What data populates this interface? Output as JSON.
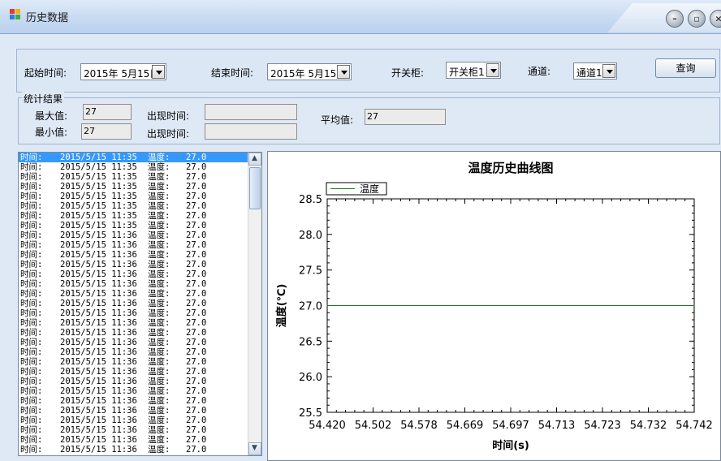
{
  "window": {
    "title": "历史数据"
  },
  "query": {
    "start_label": "起始时间:",
    "start_value": "2015年 5月15日",
    "end_label": "结束时间:",
    "end_value": "2015年 5月15日",
    "cabinet_label": "开关柜:",
    "cabinet_value": "开关柜1",
    "channel_label": "通道:",
    "channel_value": "通道1",
    "query_button": "查询"
  },
  "stats": {
    "legend": "统计结果",
    "max_label": "最大值:",
    "max_value": "27",
    "max_time_label": "出现时间:",
    "max_time_value": "",
    "min_label": "最小值:",
    "min_value": "27",
    "min_time_label": "出现时间:",
    "min_time_value": "",
    "avg_label": "平均值:",
    "avg_value": "27"
  },
  "records": [
    {
      "time_label": "时间:",
      "datetime": "2015/5/15 11:35",
      "temp_label": "温度:",
      "temp": "27.0"
    },
    {
      "time_label": "时间:",
      "datetime": "2015/5/15 11:35",
      "temp_label": "温度:",
      "temp": "27.0"
    },
    {
      "time_label": "时间:",
      "datetime": "2015/5/15 11:35",
      "temp_label": "温度:",
      "temp": "27.0"
    },
    {
      "time_label": "时间:",
      "datetime": "2015/5/15 11:35",
      "temp_label": "温度:",
      "temp": "27.0"
    },
    {
      "time_label": "时间:",
      "datetime": "2015/5/15 11:35",
      "temp_label": "温度:",
      "temp": "27.0"
    },
    {
      "time_label": "时间:",
      "datetime": "2015/5/15 11:35",
      "temp_label": "温度:",
      "temp": "27.0"
    },
    {
      "time_label": "时间:",
      "datetime": "2015/5/15 11:35",
      "temp_label": "温度:",
      "temp": "27.0"
    },
    {
      "time_label": "时间:",
      "datetime": "2015/5/15 11:35",
      "temp_label": "温度:",
      "temp": "27.0"
    },
    {
      "time_label": "时间:",
      "datetime": "2015/5/15 11:36",
      "temp_label": "温度:",
      "temp": "27.0"
    },
    {
      "time_label": "时间:",
      "datetime": "2015/5/15 11:36",
      "temp_label": "温度:",
      "temp": "27.0"
    },
    {
      "time_label": "时间:",
      "datetime": "2015/5/15 11:36",
      "temp_label": "温度:",
      "temp": "27.0"
    },
    {
      "time_label": "时间:",
      "datetime": "2015/5/15 11:36",
      "temp_label": "温度:",
      "temp": "27.0"
    },
    {
      "time_label": "时间:",
      "datetime": "2015/5/15 11:36",
      "temp_label": "温度:",
      "temp": "27.0"
    },
    {
      "time_label": "时间:",
      "datetime": "2015/5/15 11:36",
      "temp_label": "温度:",
      "temp": "27.0"
    },
    {
      "time_label": "时间:",
      "datetime": "2015/5/15 11:36",
      "temp_label": "温度:",
      "temp": "27.0"
    },
    {
      "time_label": "时间:",
      "datetime": "2015/5/15 11:36",
      "temp_label": "温度:",
      "temp": "27.0"
    },
    {
      "time_label": "时间:",
      "datetime": "2015/5/15 11:36",
      "temp_label": "温度:",
      "temp": "27.0"
    },
    {
      "time_label": "时间:",
      "datetime": "2015/5/15 11:36",
      "temp_label": "温度:",
      "temp": "27.0"
    },
    {
      "time_label": "时间:",
      "datetime": "2015/5/15 11:36",
      "temp_label": "温度:",
      "temp": "27.0"
    },
    {
      "time_label": "时间:",
      "datetime": "2015/5/15 11:36",
      "temp_label": "温度:",
      "temp": "27.0"
    },
    {
      "time_label": "时间:",
      "datetime": "2015/5/15 11:36",
      "temp_label": "温度:",
      "temp": "27.0"
    },
    {
      "time_label": "时间:",
      "datetime": "2015/5/15 11:36",
      "temp_label": "温度:",
      "temp": "27.0"
    },
    {
      "time_label": "时间:",
      "datetime": "2015/5/15 11:36",
      "temp_label": "温度:",
      "temp": "27.0"
    },
    {
      "time_label": "时间:",
      "datetime": "2015/5/15 11:36",
      "temp_label": "温度:",
      "temp": "27.0"
    },
    {
      "time_label": "时间:",
      "datetime": "2015/5/15 11:36",
      "temp_label": "温度:",
      "temp": "27.0"
    },
    {
      "time_label": "时间:",
      "datetime": "2015/5/15 11:36",
      "temp_label": "温度:",
      "temp": "27.0"
    },
    {
      "time_label": "时间:",
      "datetime": "2015/5/15 11:36",
      "temp_label": "温度:",
      "temp": "27.0"
    },
    {
      "time_label": "时间:",
      "datetime": "2015/5/15 11:36",
      "temp_label": "温度:",
      "temp": "27.0"
    },
    {
      "time_label": "时间:",
      "datetime": "2015/5/15 11:36",
      "temp_label": "温度:",
      "temp": "27.0"
    },
    {
      "time_label": "时间:",
      "datetime": "2015/5/15 11:36",
      "temp_label": "温度:",
      "temp": "27.0"
    },
    {
      "time_label": "时间:",
      "datetime": "2015/5/15 11:36",
      "temp_label": "温度:",
      "temp": "27.0"
    }
  ],
  "colors": {
    "selection": "#3399ff",
    "series_line": "#1f7a1f",
    "window_bg": "#dfe9f5"
  },
  "chart_data": {
    "type": "line",
    "title": "温度历史曲线图",
    "xlabel": "时间(s)",
    "ylabel": "温度(℃)",
    "x_tick_labels": [
      "54.420",
      "54.502",
      "54.578",
      "54.669",
      "54.697",
      "54.713",
      "54.723",
      "54.732",
      "54.742"
    ],
    "y_ticks": [
      "25.5",
      "26.0",
      "26.5",
      "27.0",
      "27.5",
      "28.0",
      "28.5"
    ],
    "ylim": [
      25.5,
      28.5
    ],
    "legend": "top-left",
    "series": [
      {
        "name": "温度",
        "color": "#1f7a1f",
        "values": [
          27.0,
          27.0,
          27.0,
          27.0,
          27.0,
          27.0,
          27.0,
          27.0,
          27.0
        ]
      }
    ]
  }
}
